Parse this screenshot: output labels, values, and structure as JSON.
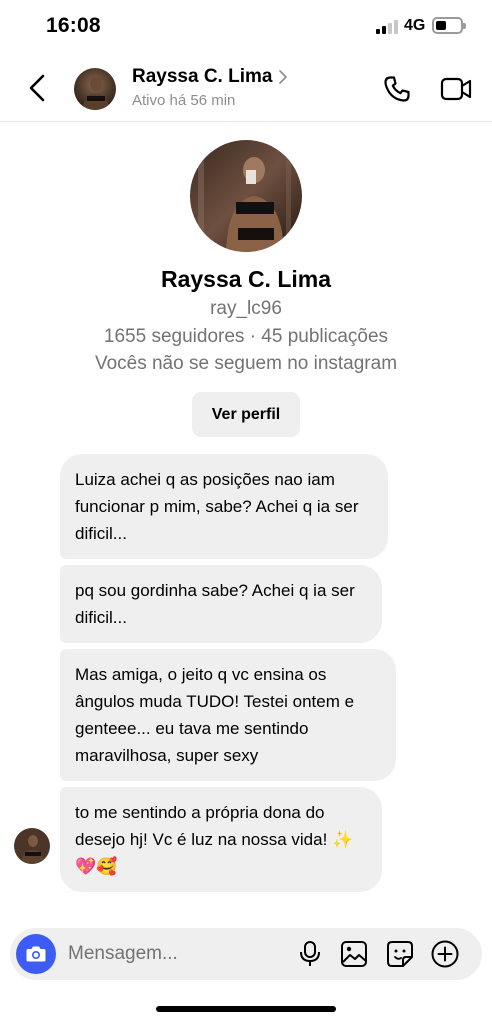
{
  "status_bar": {
    "time": "16:08",
    "network": "4G",
    "battery_level": 0.45
  },
  "header": {
    "name": "Rayssa C. Lima",
    "status": "Ativo há 56 min",
    "icons": {
      "back": "chevron-left-icon",
      "name_chevron": "chevron-right-icon",
      "call": "phone-icon",
      "video": "video-camera-icon"
    }
  },
  "profile": {
    "name": "Rayssa C. Lima",
    "username": "ray_lc96",
    "stats": "1655 seguidores · 45 publicações",
    "note": "Vocês não se seguem no instagram",
    "view_profile_label": "Ver perfil"
  },
  "messages": [
    {
      "text": "Luiza achei q as posições nao iam funcionar p mim, sabe? Achei q ia ser dificil..."
    },
    {
      "text": "pq sou gordinha sabe? Achei q ia ser dificil..."
    },
    {
      "text": "Mas amiga, o jeito q vc ensina os ângulos muda TUDO! Testei ontem e genteee... eu tava me sentindo maravilhosa, super sexy"
    },
    {
      "text": "to me sentindo a própria dona do desejo hj! Vc é luz na nossa vida! ✨💖🥰"
    }
  ],
  "composer": {
    "placeholder": "Mensagem...",
    "icons": {
      "camera": "camera-icon",
      "mic": "microphone-icon",
      "gallery": "image-gallery-icon",
      "sticker": "sticker-icon",
      "plus": "plus-circle-icon"
    }
  },
  "colors": {
    "accent": "#3d5bf5",
    "bubble": "#efefef",
    "muted_text": "#737373"
  }
}
